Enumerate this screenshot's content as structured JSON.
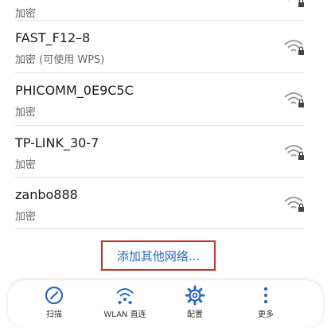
{
  "networks": [
    {
      "name": "",
      "security": "加密"
    },
    {
      "name": "FAST_F12–8",
      "security": "加密 (可使用 WPS)"
    },
    {
      "name": "PHICOMM_0E9C5C",
      "security": "加密"
    },
    {
      "name": "TP-LINK_30-7",
      "security": "加密"
    },
    {
      "name": "zanbo888",
      "security": "加密"
    }
  ],
  "add_network_label": "添加其他网络...",
  "toolbar": {
    "scan_label": "扫描",
    "wlan_direct_label": "WLAN 直连",
    "config_label": "配置",
    "more_label": "更多"
  },
  "colors": {
    "accent": "#2a67c9",
    "highlight_border": "#c4312f",
    "wifi_icon": "#9a9a9a"
  }
}
